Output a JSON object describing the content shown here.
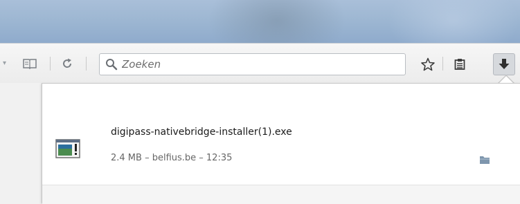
{
  "toolbar": {
    "search": {
      "placeholder": "Zoeken",
      "icon": "search-icon"
    },
    "icons": {
      "reader": "reader-view-icon",
      "reload": "reload-icon",
      "bookmark": "bookmark-star-icon",
      "reading_list": "reading-list-icon",
      "downloads": "downloads-arrow-icon"
    }
  },
  "downloads": {
    "items": [
      {
        "filename": "digipass-nativebridge-installer(1).exe",
        "status": "2.4 MB – belfius.be – 12:35",
        "icon": "executable-file-icon",
        "action_icon": "open-folder-icon"
      }
    ]
  },
  "colors": {
    "titlebar": "#9fb8d3",
    "toolbar": "#ececec",
    "panel": "#ffffff",
    "accent_green": "#3f8f45"
  }
}
